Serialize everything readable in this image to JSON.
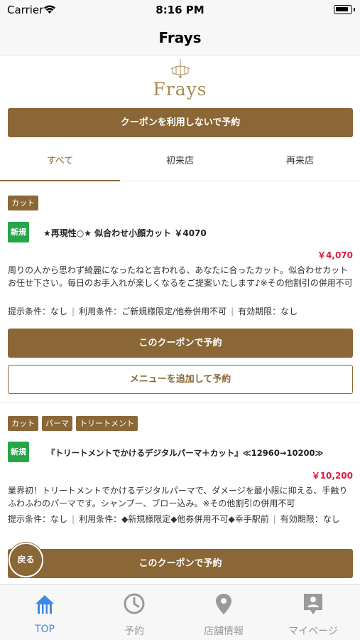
{
  "status_bar": {
    "carrier": "Carrier",
    "time": "8:16 PM"
  },
  "nav": {
    "title": "Frays"
  },
  "logo": {
    "text": "Frays"
  },
  "reserve_without_coupon": "クーポンを利用しないで予約",
  "tabs": [
    {
      "label": "すべて",
      "active": true
    },
    {
      "label": "初来店",
      "active": false
    },
    {
      "label": "再来店",
      "active": false
    }
  ],
  "coupons": [
    {
      "tags": [
        "カット"
      ],
      "badge": "新規",
      "title": "★再現性○★ 似合わせ小顔カット ￥4070",
      "price": "￥4,070",
      "desc": "周りの人から思わず綺麗になったねと言われる、あなたに合ったカット。似合わせカットお任せ下さい。毎日のお手入れが楽しくなるをご提案いたします♪※その他割引の併用不可",
      "conditions": {
        "display": "提示条件：なし",
        "usage": "利用条件：ご新規様限定/他券併用不可",
        "expiry": "有効期限：なし"
      },
      "reserve_label": "このクーポンで予約",
      "add_menu_label": "メニューを追加して予約"
    },
    {
      "tags": [
        "カット",
        "パーマ",
        "トリートメント"
      ],
      "badge": "新規",
      "title": "『トリートメントでかけるデジタルパーマ＋カット』≪12960→10200≫",
      "price": "￥10,200",
      "desc": "業界初！トリートメントでかけるデジタルパーマで、ダメージを最小限に抑える、手触りふわふわのパーマです。シャンプー、ブロー込み。※その他割引の併用不可",
      "conditions": {
        "display": "提示条件：なし",
        "usage": "利用条件：◆新規様限定◆他券併用不可◆幸手駅前",
        "expiry": "有効期限：なし"
      },
      "reserve_label": "このクーポンで予約"
    }
  ],
  "back_button": "戻る",
  "tab_bar": [
    {
      "label": "TOP",
      "icon": "home-icon",
      "active": true
    },
    {
      "label": "予約",
      "icon": "clock-icon",
      "active": false
    },
    {
      "label": "店舗情報",
      "icon": "map-pin-icon",
      "active": false
    },
    {
      "label": "マイページ",
      "icon": "profile-icon",
      "active": false
    }
  ],
  "colors": {
    "brand_brown": "#8b6737",
    "new_badge_green": "#27a549",
    "price_red": "#e0173c",
    "active_tab_blue": "#3d8ae6"
  }
}
